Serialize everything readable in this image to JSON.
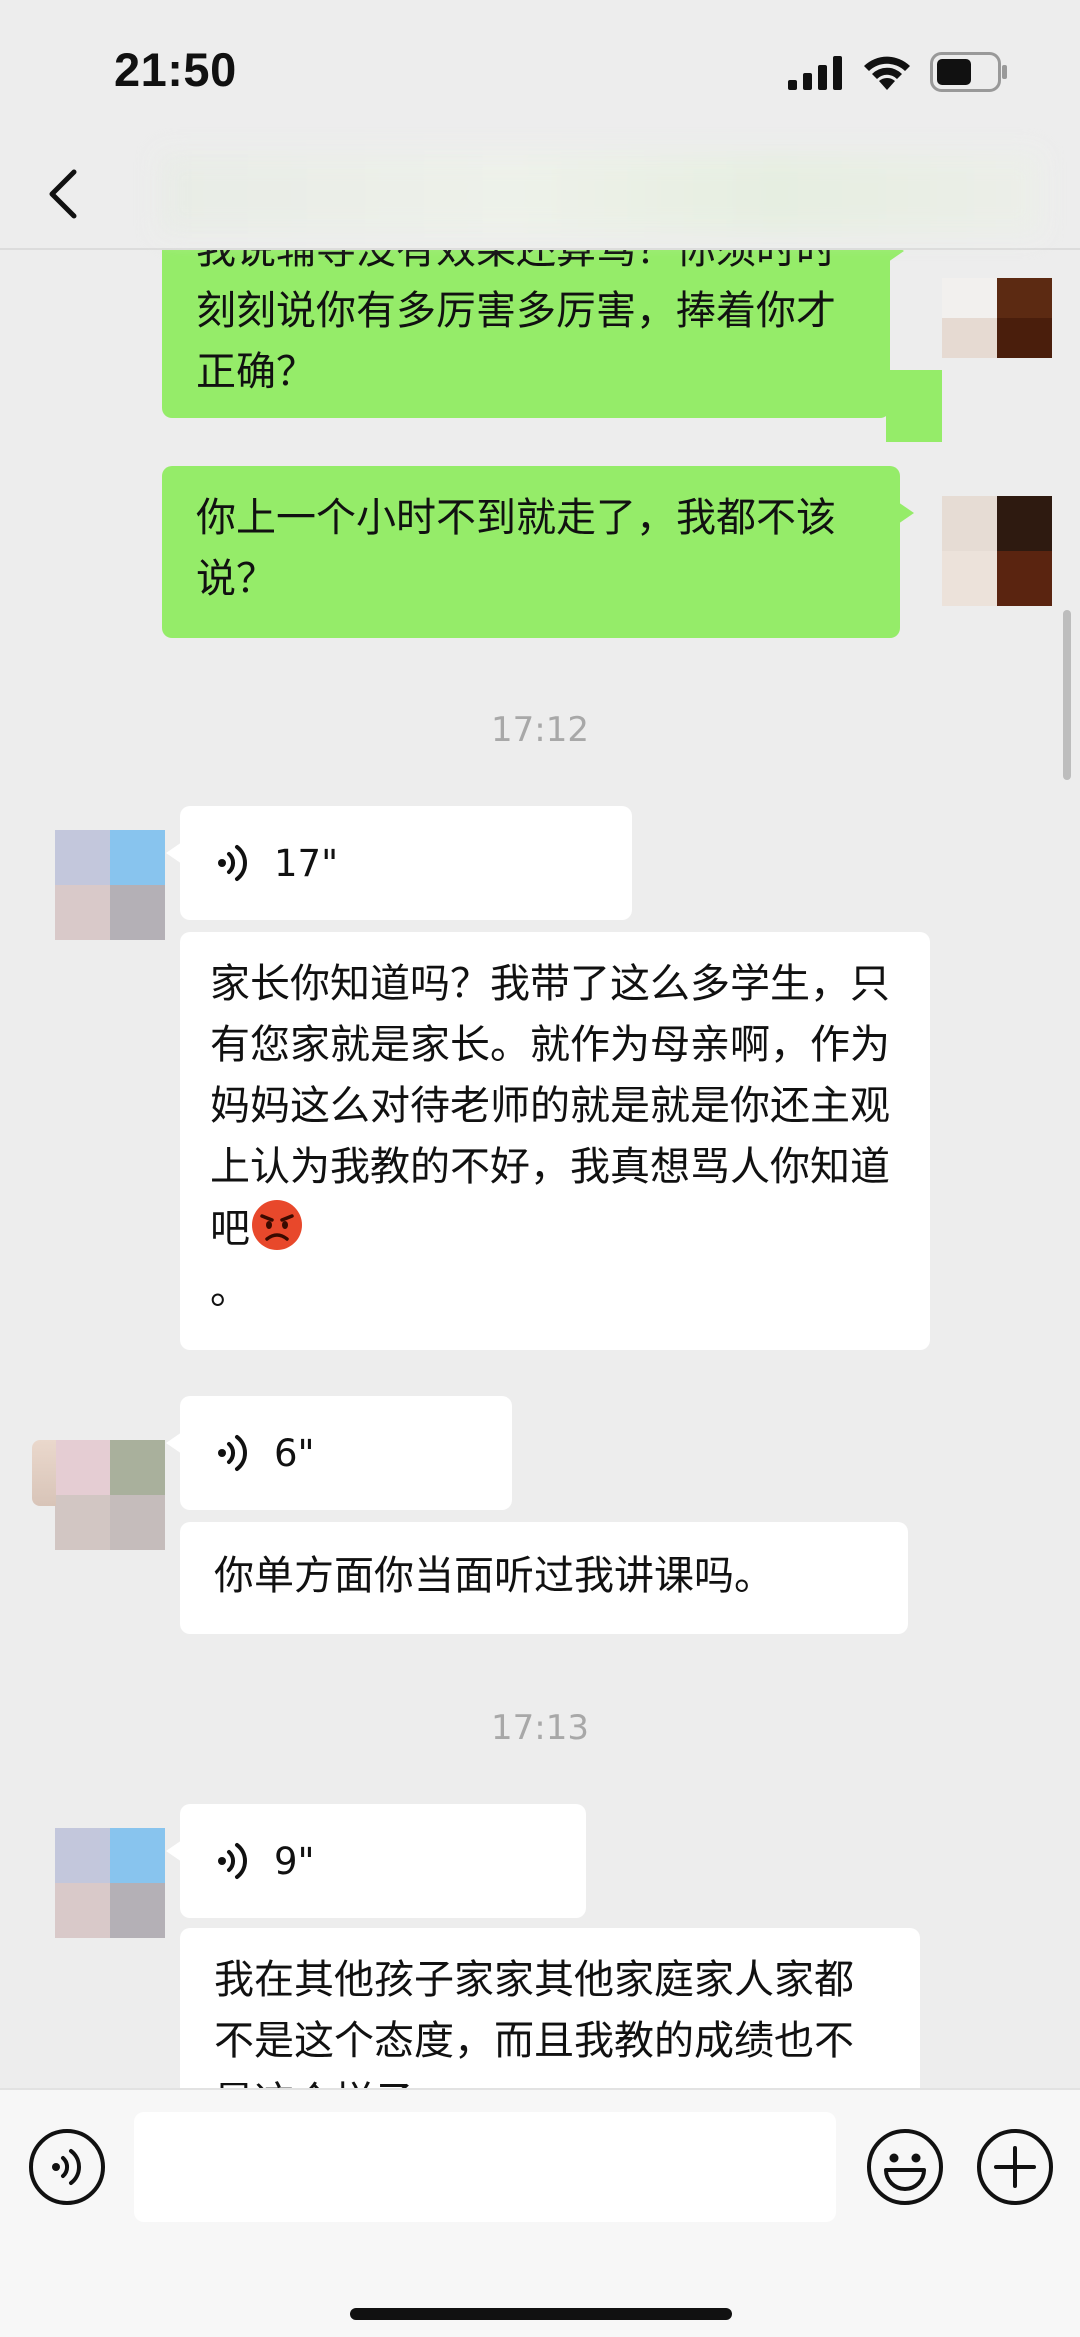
{
  "status_bar": {
    "time": "21:50",
    "icons": [
      "signal-icon",
      "wifi-icon",
      "battery-icon"
    ]
  },
  "nav": {
    "back_icon": "chevron-left-icon",
    "title": ""
  },
  "chat": {
    "messages": [
      {
        "kind": "text",
        "side": "out",
        "text": "我说辅导没有效果还算骂？你须时时刻刻说你有多厉害多厉害，捧着你才正确？"
      },
      {
        "kind": "text",
        "side": "out",
        "text": "你上一个小时不到就走了，我都不该说？"
      },
      {
        "kind": "timestamp",
        "text": "17:12"
      },
      {
        "kind": "voice",
        "side": "in",
        "duration": "17\""
      },
      {
        "kind": "text",
        "side": "in",
        "text": "家长你知道吗？我带了这么多学生，只有您家就是家长。就作为母亲啊，作为妈妈这么对待老师的就是就是你还主观上认为我教的不好，我真想骂人你知道吧",
        "emoji": "angry-face-icon",
        "text_after_emoji": "。"
      },
      {
        "kind": "voice",
        "side": "in",
        "duration": "6\""
      },
      {
        "kind": "text",
        "side": "in",
        "text": "你单方面你当面听过我讲课吗。"
      },
      {
        "kind": "timestamp",
        "text": "17:13"
      },
      {
        "kind": "voice",
        "side": "in",
        "duration": "9\""
      },
      {
        "kind": "text",
        "side": "in",
        "text": "我在其他孩子家家其他家庭家人家都不是这个态度，而且我教的成绩也不是这个样子"
      }
    ]
  },
  "input_bar": {
    "voice_toggle_icon": "voice-mode-icon",
    "placeholder": "",
    "emoji_icon": "smiley-icon",
    "plus_icon": "plus-icon"
  },
  "colors": {
    "outgoing_bubble": "#95ec69",
    "incoming_bubble": "#ffffff",
    "background": "#ededed",
    "timestamp": "#a8a8a8"
  }
}
